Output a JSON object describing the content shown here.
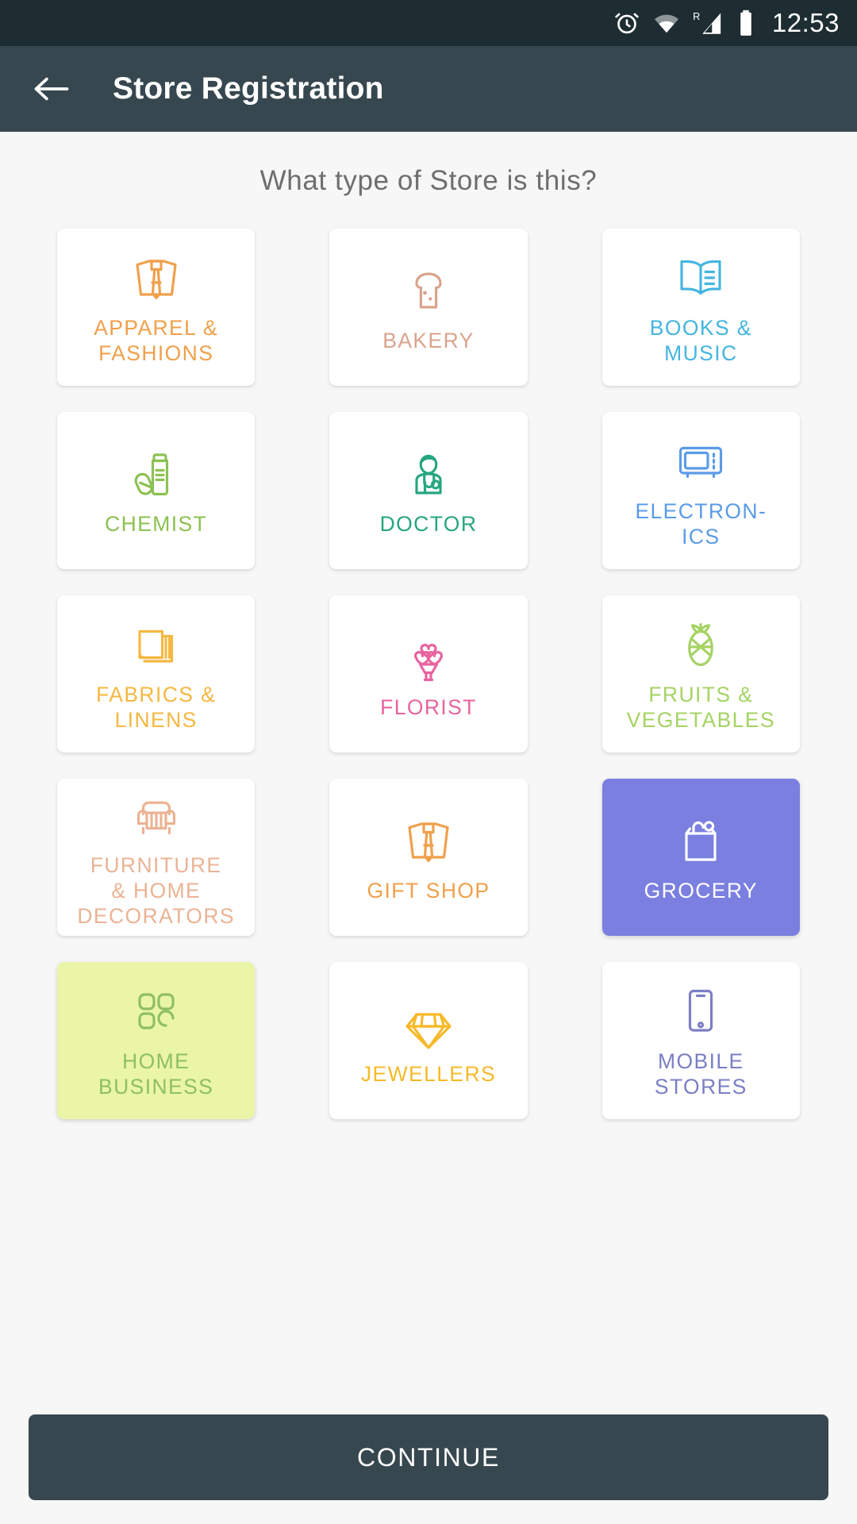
{
  "status_bar": {
    "time": "12:53",
    "icons": [
      "alarm-icon",
      "wifi-icon",
      "signal-roaming-icon",
      "battery-icon"
    ],
    "background": "#1E2D31"
  },
  "app_bar": {
    "back_icon": "back-arrow-icon",
    "title": "Store Registration",
    "background": "#37474F"
  },
  "main": {
    "question": "What type of Store is this?",
    "question_color": "#6E6E6E",
    "background": "#F7F7F7"
  },
  "categories": [
    {
      "id": "apparel-fashions",
      "label": "APPAREL &\nFASHIONS",
      "icon": "shirt-tie-icon",
      "color": "#F0A04B",
      "selected": false,
      "card_bg": "#FFFFFF"
    },
    {
      "id": "bakery",
      "label": "BAKERY",
      "icon": "bread-slice-icon",
      "color": "#D9A38C",
      "selected": false,
      "card_bg": "#FFFFFF"
    },
    {
      "id": "books-music",
      "label": "BOOKS &\nMUSIC",
      "icon": "open-book-icon",
      "color": "#45B5E0",
      "selected": false,
      "card_bg": "#FFFFFF"
    },
    {
      "id": "chemist",
      "label": "CHEMIST",
      "icon": "medicine-bottle-pills-icon",
      "color": "#8CC152",
      "selected": false,
      "card_bg": "#FFFFFF"
    },
    {
      "id": "doctor",
      "label": "DOCTOR",
      "icon": "doctor-stethoscope-icon",
      "color": "#26A67F",
      "selected": false,
      "card_bg": "#FFFFFF"
    },
    {
      "id": "electronics",
      "label": "ELECTRON-\nICS",
      "icon": "microwave-icon",
      "color": "#5B9BE8",
      "selected": false,
      "card_bg": "#FFFFFF"
    },
    {
      "id": "fabrics-linens",
      "label": "FABRICS &\nLINENS",
      "icon": "folded-cloth-icon",
      "color": "#F5B841",
      "selected": false,
      "card_bg": "#FFFFFF"
    },
    {
      "id": "florist",
      "label": "FLORIST",
      "icon": "flower-bouquet-icon",
      "color": "#E8639F",
      "selected": false,
      "card_bg": "#FFFFFF"
    },
    {
      "id": "fruits-vegetables",
      "label": "FRUITS &\nVEGETABLES",
      "icon": "pineapple-icon",
      "color": "#A5D363",
      "selected": false,
      "card_bg": "#FFFFFF"
    },
    {
      "id": "furniture-home-decorators",
      "label": "FURNITURE\n& HOME\nDECORATORS",
      "icon": "armchair-icon",
      "color": "#EBB394",
      "selected": false,
      "card_bg": "#FFFFFF"
    },
    {
      "id": "gift-shop",
      "label": "GIFT SHOP",
      "icon": "gift-bag-icon",
      "color": "#F0A04B",
      "selected": false,
      "card_bg": "#FFFFFF"
    },
    {
      "id": "grocery",
      "label": "GROCERY",
      "icon": "grocery-bag-icon",
      "color": "#FFFFFF",
      "selected": true,
      "card_bg": "#7B7FE0"
    },
    {
      "id": "home-business",
      "label": "HOME\nBUSINESS",
      "icon": "blocks-grid-icon",
      "color": "#8FBF63",
      "selected": true,
      "card_bg": "#EAF5A8"
    },
    {
      "id": "jewellers",
      "label": "JEWELLERS",
      "icon": "diamond-icon",
      "color": "#F7B928",
      "selected": false,
      "card_bg": "#FFFFFF"
    },
    {
      "id": "mobile-stores",
      "label": "MOBILE\nSTORES",
      "icon": "smartphone-icon",
      "color": "#7B7FC4",
      "selected": false,
      "card_bg": "#FFFFFF"
    }
  ],
  "footer": {
    "continue_label": "CONTINUE",
    "background": "#37474F"
  }
}
